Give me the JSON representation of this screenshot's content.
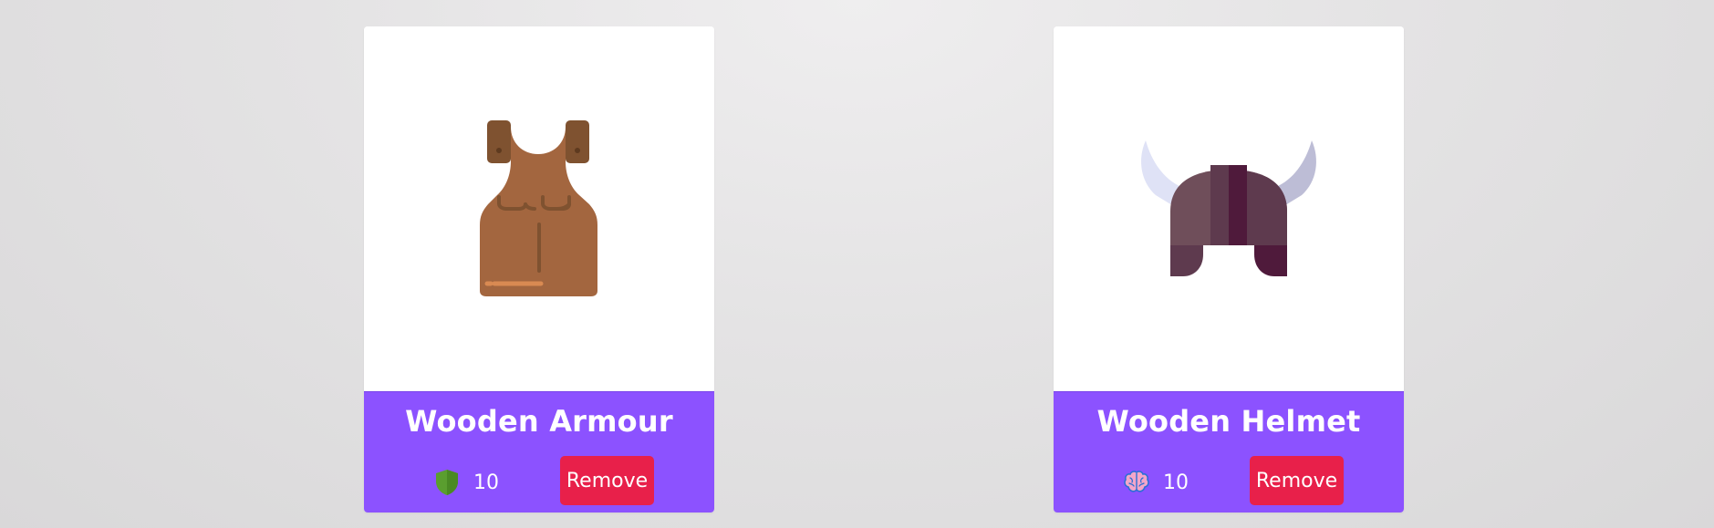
{
  "theme": {
    "footer_color": "#8c52ff",
    "remove_button_color": "#e8204a",
    "card_background": "#ffffff"
  },
  "cards": [
    {
      "title": "Wooden Armour",
      "image_icon": "wooden-armour-icon",
      "stat_icon": "shield-icon",
      "stat_value": "10",
      "remove_label": "Remove"
    },
    {
      "title": "Wooden Helmet",
      "image_icon": "viking-helmet-icon",
      "stat_icon": "brain-icon",
      "stat_value": "10",
      "remove_label": "Remove"
    }
  ]
}
